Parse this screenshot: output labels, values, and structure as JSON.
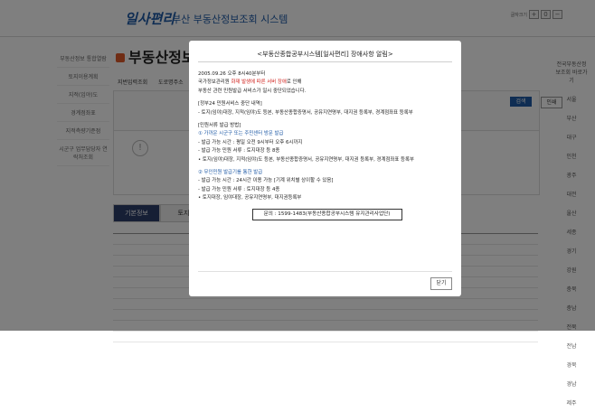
{
  "header": {
    "logo": "일사편리",
    "title": "부산  부동산정보조회 시스템",
    "font_label": "글자크기"
  },
  "left_nav": [
    "부동산정보 통합열람",
    "토지이용계획",
    "지적(임야)도",
    "경계점좌표",
    "지적측량기준점",
    "시군구 업무담당자 연락처조회"
  ],
  "main": {
    "page_title": "부동산정보",
    "radio_1": "지번입력조회",
    "radio_2": "도로명주소",
    "search_btn": "검색",
    "print_btn": "인쇄",
    "tab_1": "기본정보",
    "tab_2": "토지"
  },
  "right_nav": [
    "전국부동산정보조회 바로가기",
    "서울",
    "부산",
    "대구",
    "인천",
    "광주",
    "대전",
    "울산",
    "세종",
    "경기",
    "강원",
    "충북",
    "충남",
    "전북",
    "전남",
    "경북",
    "경남",
    "제주"
  ],
  "modal": {
    "title": "<부동산종합공부시스템[일사편리] 장애사항 알림>",
    "l1": "2005.09.26 오후 8시40분부터",
    "l2a": "국가정보관리원 ",
    "l2b": "화재 발생에 따른 서버 장애",
    "l2c": "로 인해",
    "l3": "부동산 관련 민원발급 서비스가 일시 중단되었습니다.",
    "s1": "[정부24 민원서비스 중단 내역]",
    "s1a": " - 토지(임야)대장, 지적(임야)도 등본, 부동산종합증명서, 공유지연명부, 대지권 등록부, 경계점좌표 등록부",
    "s2": "[민원서류 발급 방법]",
    "s3": "① 가까운 시군구 또는 주민센터 방문 발급",
    "s3a": " - 발급 가능 시간 : 평일 오전 9시부터 오후 6시까지",
    "s3b": " - 발급 가능 민원 서류 : 토지대장 등 8종",
    "s3c": "  • 토지(임야)대장, 지적(임야)도 등본, 부동산종합증명서, 공유지연명부, 대지권 등록부, 경계점좌표 등록부",
    "s4": "② 무인민원 발급기를 통한 발급",
    "s4a": " - 발급 가능 시간 : 24시간 이용 가능 [기계 위치별 상이할 수 있음]",
    "s4b": " - 발급 가능 민원 서류 : 토지대장 등 4종",
    "s4c": "  • 토지대장, 임야대장, 공유지연명부, 대지권등록부",
    "contact": "문의 : 1599-1483(부동산종합공부시스템 유지관리사업단)",
    "close": "닫기"
  }
}
